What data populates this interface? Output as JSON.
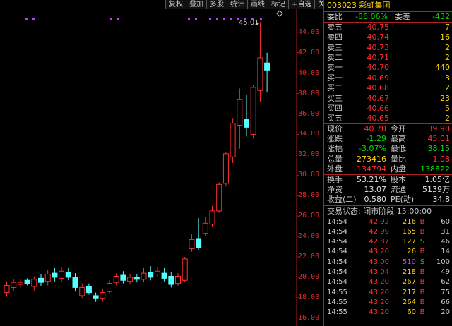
{
  "toolbar": {
    "items": [
      "复权",
      "叠加",
      "多股",
      "统计",
      "画线",
      "标记",
      "+自选"
    ],
    "close": "关闭"
  },
  "chart_data": {
    "type": "candlestick",
    "y_ticks": [
      "44.00",
      "42.00",
      "40.00",
      "38.00",
      "36.00",
      "34.00",
      "32.00",
      "30.00",
      "28.00",
      "26.00",
      "24.00",
      "22.00",
      "20.00",
      "18.00",
      "16.00"
    ],
    "ylim": [
      15.5,
      46.2
    ],
    "peak_label": "45.01",
    "candles": [
      {
        "o": 18.5,
        "c": 19.2,
        "h": 19.6,
        "l": 18.1
      },
      {
        "o": 19.0,
        "c": 19.5,
        "h": 19.8,
        "l": 18.6
      },
      {
        "o": 19.3,
        "c": 19.5,
        "h": 19.8,
        "l": 19.0
      },
      {
        "o": 19.7,
        "c": 19.4,
        "h": 19.9,
        "l": 19.2
      },
      {
        "o": 19.1,
        "c": 19.8,
        "h": 20.1,
        "l": 18.7
      },
      {
        "o": 19.9,
        "c": 19.5,
        "h": 20.3,
        "l": 19.1
      },
      {
        "o": 19.6,
        "c": 20.3,
        "h": 20.7,
        "l": 19.2
      },
      {
        "o": 20.4,
        "c": 20.0,
        "h": 20.9,
        "l": 19.6
      },
      {
        "o": 19.9,
        "c": 20.6,
        "h": 21.0,
        "l": 19.6
      },
      {
        "o": 20.5,
        "c": 20.0,
        "h": 20.9,
        "l": 19.7
      },
      {
        "o": 20.0,
        "c": 19.0,
        "h": 20.4,
        "l": 18.6
      },
      {
        "o": 18.2,
        "c": 19.0,
        "h": 19.4,
        "l": 17.9
      },
      {
        "o": 19.1,
        "c": 18.5,
        "h": 19.4,
        "l": 18.3
      },
      {
        "o": 18.2,
        "c": 17.9,
        "h": 18.5,
        "l": 17.6
      },
      {
        "o": 17.9,
        "c": 18.5,
        "h": 18.9,
        "l": 17.6
      },
      {
        "o": 18.6,
        "c": 19.4,
        "h": 19.7,
        "l": 18.4
      },
      {
        "o": 19.5,
        "c": 20.1,
        "h": 20.4,
        "l": 19.2
      },
      {
        "o": 20.2,
        "c": 19.7,
        "h": 20.6,
        "l": 19.4
      },
      {
        "o": 19.6,
        "c": 20.0,
        "h": 20.3,
        "l": 19.3
      },
      {
        "o": 20.0,
        "c": 19.8,
        "h": 20.3,
        "l": 19.5
      },
      {
        "o": 19.8,
        "c": 20.4,
        "h": 20.9,
        "l": 19.5
      },
      {
        "o": 20.5,
        "c": 20.0,
        "h": 21.1,
        "l": 19.7
      },
      {
        "o": 20.3,
        "c": 20.6,
        "h": 21.0,
        "l": 20.0
      },
      {
        "o": 20.4,
        "c": 19.9,
        "h": 20.9,
        "l": 19.6
      },
      {
        "o": 20.1,
        "c": 19.3,
        "h": 20.5,
        "l": 19.0
      },
      {
        "o": 19.4,
        "c": 20.1,
        "h": 20.4,
        "l": 19.1
      },
      {
        "o": 19.7,
        "c": 21.8,
        "h": 22.0,
        "l": 19.5
      },
      {
        "o": 22.8,
        "c": 23.7,
        "h": 24.2,
        "l": 22.5
      },
      {
        "o": 23.8,
        "c": 22.9,
        "h": 25.8,
        "l": 22.7
      },
      {
        "o": 24.3,
        "c": 25.3,
        "h": 25.9,
        "l": 24.0
      },
      {
        "o": 25.2,
        "c": 26.5,
        "h": 27.0,
        "l": 24.9
      },
      {
        "o": 26.5,
        "c": 29.1,
        "h": 29.3,
        "l": 26.3
      },
      {
        "o": 29.2,
        "c": 32.1,
        "h": 32.3,
        "l": 28.9
      },
      {
        "o": 31.8,
        "c": 35.1,
        "h": 35.6,
        "l": 31.2
      },
      {
        "o": 34.9,
        "c": 37.4,
        "h": 38.5,
        "l": 32.6
      },
      {
        "o": 35.5,
        "c": 34.7,
        "h": 37.9,
        "l": 33.8
      },
      {
        "o": 34.0,
        "c": 38.6,
        "h": 38.8,
        "l": 33.6
      },
      {
        "o": 38.3,
        "c": 41.5,
        "h": 45.01,
        "l": 37.2
      },
      {
        "o": 41.0,
        "c": 40.3,
        "h": 42.0,
        "l": 38.1
      }
    ],
    "colors": {
      "up": "#ff3030",
      "down": "#54ffff",
      "axis": "#aa2222"
    }
  },
  "quote": {
    "title": "003023 彩虹集团",
    "ratio": {
      "label1": "委比",
      "value1": "-86.06%",
      "label2": "委差",
      "value2": "-432"
    },
    "asks": [
      {
        "label": "卖五",
        "price": "40.75",
        "vol": "7"
      },
      {
        "label": "卖四",
        "price": "40.74",
        "vol": "16"
      },
      {
        "label": "卖三",
        "price": "40.73",
        "vol": "2"
      },
      {
        "label": "卖二",
        "price": "40.71",
        "vol": "2"
      },
      {
        "label": "卖一",
        "price": "40.70",
        "vol": "440"
      }
    ],
    "bids": [
      {
        "label": "买一",
        "price": "40.69",
        "vol": "3"
      },
      {
        "label": "买二",
        "price": "40.68",
        "vol": "2"
      },
      {
        "label": "买三",
        "price": "40.67",
        "vol": "23"
      },
      {
        "label": "买四",
        "price": "40.66",
        "vol": "5"
      },
      {
        "label": "买五",
        "price": "40.65",
        "vol": "2"
      }
    ],
    "stats1": [
      {
        "l1": "现价",
        "v1": "40.70",
        "c1": "red",
        "l2": "今开",
        "v2": "39.90",
        "c2": "red"
      },
      {
        "l1": "涨跌",
        "v1": "-1.29",
        "c1": "green",
        "l2": "最高",
        "v2": "45.01",
        "c2": "red"
      },
      {
        "l1": "涨幅",
        "v1": "-3.07%",
        "c1": "green",
        "l2": "最低",
        "v2": "38.15",
        "c2": "green"
      },
      {
        "l1": "总量",
        "v1": "273416",
        "c1": "yellow",
        "l2": "量比",
        "v2": "1.08",
        "c2": "red"
      },
      {
        "l1": "外盘",
        "v1": "134794",
        "c1": "red",
        "l2": "内盘",
        "v2": "138622",
        "c2": "green"
      }
    ],
    "stats2": [
      {
        "l1": "换手",
        "v1": "53.21%",
        "l2": "股本",
        "v2": "1.05亿"
      },
      {
        "l1": "净资",
        "v1": "13.07",
        "l2": "流通",
        "v2": "5139万"
      },
      {
        "l1": "收益(二)",
        "v1": "0.580",
        "l2": "PE(动)",
        "v2": "34.8"
      }
    ],
    "status": "交易状态: 闭市阶段 15:00:00",
    "ticks": [
      {
        "t": "14:54",
        "p": "42.92",
        "v": "216",
        "d": "B",
        "n": "60",
        "vc": "yellow"
      },
      {
        "t": "14:54",
        "p": "42.99",
        "v": "165",
        "d": "B",
        "n": "31",
        "vc": "yellow"
      },
      {
        "t": "14:54",
        "p": "42.87",
        "v": "127",
        "d": "S",
        "n": "46",
        "vc": "yellow"
      },
      {
        "t": "14:54",
        "p": "43.20",
        "v": "26",
        "d": "B",
        "n": "14",
        "vc": "yellow"
      },
      {
        "t": "14:54",
        "p": "43.00",
        "v": "510",
        "d": "S",
        "n": "100",
        "vc": "purple"
      },
      {
        "t": "14:54",
        "p": "43.04",
        "v": "218",
        "d": "B",
        "n": "49",
        "vc": "yellow"
      },
      {
        "t": "14:54",
        "p": "43.20",
        "v": "267",
        "d": "B",
        "n": "62",
        "vc": "yellow"
      },
      {
        "t": "14:55",
        "p": "43.20",
        "v": "217",
        "d": "B",
        "n": "75",
        "vc": "yellow"
      },
      {
        "t": "14:55",
        "p": "43.20",
        "v": "264",
        "d": "B",
        "n": "66",
        "vc": "yellow"
      },
      {
        "t": "14:55",
        "p": "43.20",
        "v": "60",
        "d": "B",
        "n": "20",
        "vc": "yellow"
      }
    ]
  }
}
